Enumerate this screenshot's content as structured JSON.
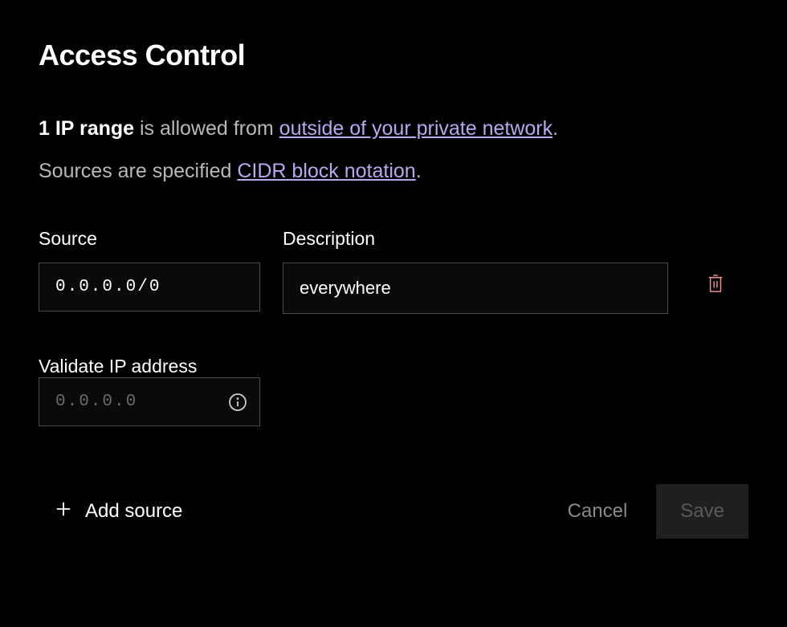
{
  "title": "Access Control",
  "summary": {
    "prefix_bold": "1 IP range",
    "mid_text": " is allowed from ",
    "link1_text": "outside of your private network",
    "period": "."
  },
  "cidr_line": {
    "prefix": "Sources are specified ",
    "link_text": "CIDR block notation",
    "period": "."
  },
  "labels": {
    "source": "Source",
    "description": "Description",
    "validate": "Validate IP address"
  },
  "rows": [
    {
      "source": "0.0.0.0/0",
      "description": "everywhere"
    }
  ],
  "validate": {
    "placeholder": "0.0.0.0",
    "value": ""
  },
  "buttons": {
    "add_source": "Add source",
    "cancel": "Cancel",
    "save": "Save"
  }
}
